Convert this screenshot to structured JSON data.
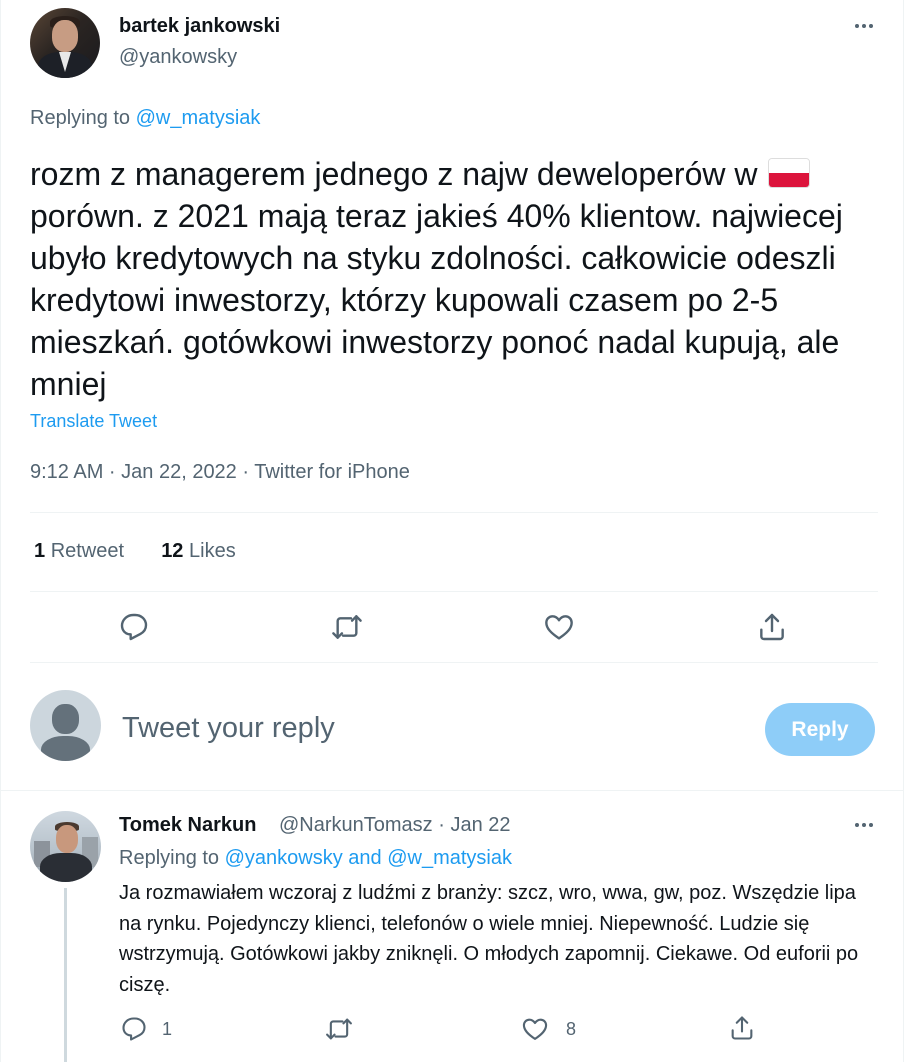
{
  "main_tweet": {
    "author_name": "bartek jankowski",
    "author_handle": "@yankowsky",
    "replying_label": "Replying to",
    "replying_to": "@w_matysiak",
    "text": "rozm z managerem jednego z najw deweloperów w",
    "text_rest": "porówn. z 2021 mają teraz jakieś 40% klientow. najwiecej ubyło kredytowych na styku zdolności. całkowicie odeszli kredytowi inwestorzy, którzy kupowali czasem po 2-5 mieszkań. gotówkowi inwestorzy ponoć nadal kupują, ale mniej",
    "flag_icon": "poland-flag-icon",
    "translate_label": "Translate Tweet",
    "meta": "9:12 AM · Jan 22, 2022 · Twitter for iPhone",
    "retweet_count": "1",
    "retweet_label": "Retweet",
    "like_count": "12",
    "like_label": "Likes"
  },
  "reply_composer": {
    "placeholder": "Tweet your reply",
    "button_label": "Reply"
  },
  "reply_tweet": {
    "author_name": "Tomek Narkun",
    "author_handle_date": "@NarkunTomasz · Jan 22",
    "replying_label": "Replying to",
    "replying_to": "@yankowsky and @w_matysiak",
    "text": "Ja rozmawiałem wczoraj z ludźmi z branży: szcz, wro, wwa, gw, poz. Wszędzie lipa na rynku. Pojedynczy klienci, telefonów o wiele mniej. Niepewność. Ludzie się wstrzymują. Gotówkowi jakby zniknęli. O młodych zapomnij. Ciekawe. Od euforii po ciszę.",
    "reply_count": "1",
    "like_count": "8"
  },
  "colors": {
    "accent": "#1d9bf0",
    "secondary_text": "#536471",
    "reply_button_disabled": "#8ecdf8"
  }
}
